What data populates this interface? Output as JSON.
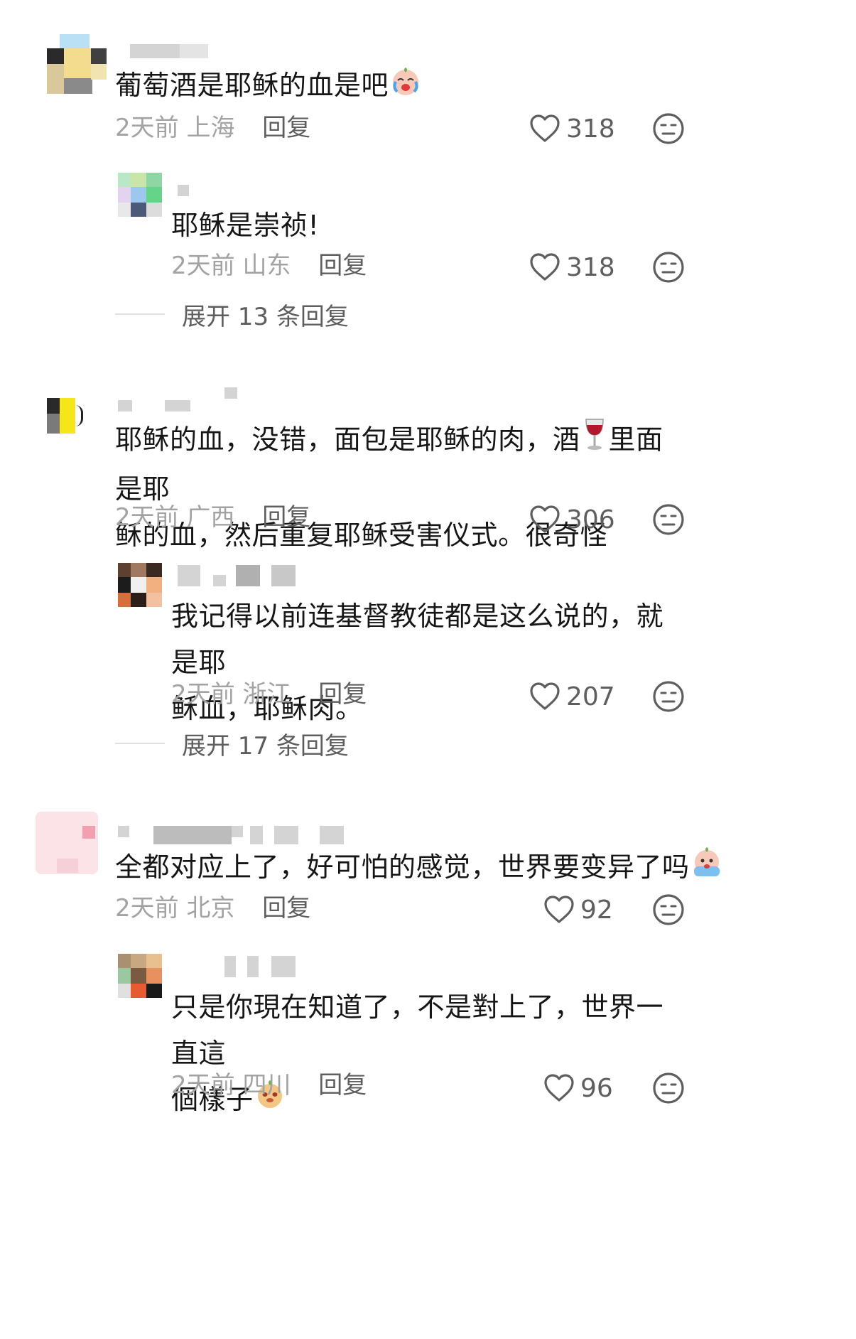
{
  "comments": [
    {
      "text": "葡萄酒是耶稣的血是吧",
      "time": "2天前",
      "location": "上海",
      "reply_label": "回复",
      "likes": "318",
      "replies": [
        {
          "text": "耶稣是崇祯!",
          "time": "2天前",
          "location": "山东",
          "reply_label": "回复",
          "likes": "318"
        }
      ],
      "expand_label": "展开 13 条回复"
    },
    {
      "text_line1": "耶稣的血，没错，面包是耶稣的肉，酒",
      "text_line1b": "里面是耶",
      "text_line2": "稣的血，然后重复耶稣受害仪式。很奇怪",
      "time": "2天前",
      "location": "广西",
      "reply_label": "回复",
      "likes": "306",
      "replies": [
        {
          "text_line1": "我记得以前连基督教徒都是这么说的，就是耶",
          "text_line2": "稣血，耶稣肉。",
          "time": "2天前",
          "location": "浙江",
          "reply_label": "回复",
          "likes": "207"
        }
      ],
      "expand_label": "展开 17 条回复"
    },
    {
      "text": "全都对应上了，好可怕的感觉，世界要变异了吗",
      "time": "2天前",
      "location": "北京",
      "reply_label": "回复",
      "likes": "92",
      "replies": [
        {
          "text_line1": "只是你現在知道了，不是對上了，世界一直這",
          "text_line2": "個樣子",
          "time": "2天前",
          "location": "四川",
          "reply_label": "回复",
          "likes": "96"
        }
      ]
    }
  ],
  "colors": {
    "text": "#161616",
    "meta": "#a3a3a3",
    "action": "#5e5e5e"
  },
  "icons": [
    "heart-icon",
    "dislike-face-icon",
    "crying-emoji-icon",
    "wine-glass-icon",
    "sweat-emoji-icon",
    "smirk-emoji-icon"
  ]
}
